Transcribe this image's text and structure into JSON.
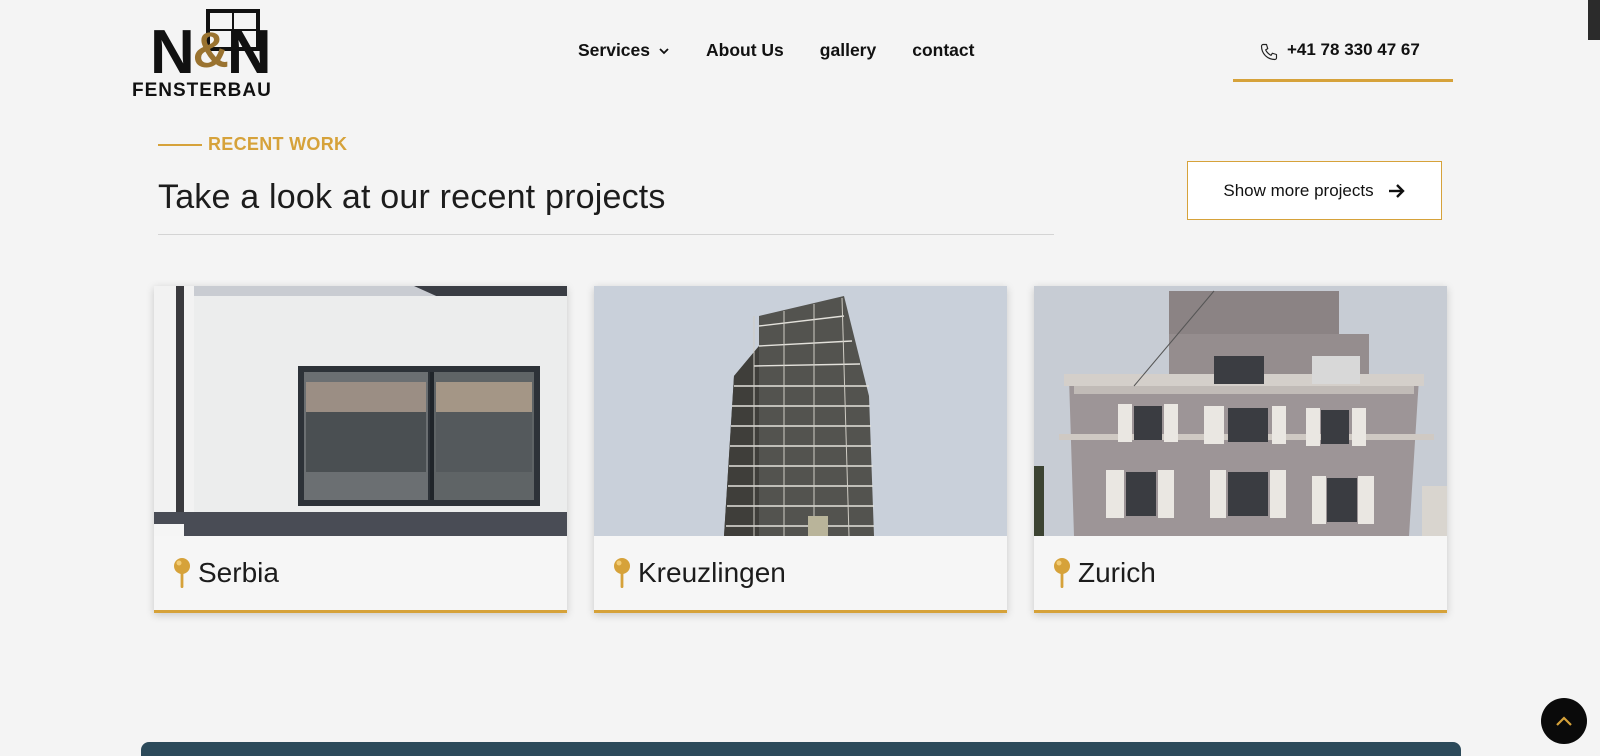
{
  "brand": {
    "logo_main": "N&N",
    "logo_sub": "FENSTERBAU"
  },
  "nav": {
    "items": [
      {
        "label": "Services",
        "has_dropdown": true
      },
      {
        "label": "About Us"
      },
      {
        "label": "gallery"
      },
      {
        "label": "contact"
      }
    ]
  },
  "contact": {
    "phone": "+41 78 330 47 67"
  },
  "section": {
    "eyebrow": "RECENT WORK",
    "title": "Take a look at our recent projects",
    "more_button": "Show more projects"
  },
  "projects": [
    {
      "location": "Serbia"
    },
    {
      "location": "Kreuzlingen"
    },
    {
      "location": "Zurich"
    }
  ],
  "colors": {
    "accent": "#d6a23a",
    "background": "#f4f4f4",
    "banner": "#2c4a5a",
    "text": "#1c1c1c"
  },
  "icons": {
    "phone": "phone-icon",
    "dropdown": "chevron-down-icon",
    "arrow": "arrow-right-icon",
    "pin": "map-pin-icon",
    "back_to_top": "chevron-up-icon"
  }
}
